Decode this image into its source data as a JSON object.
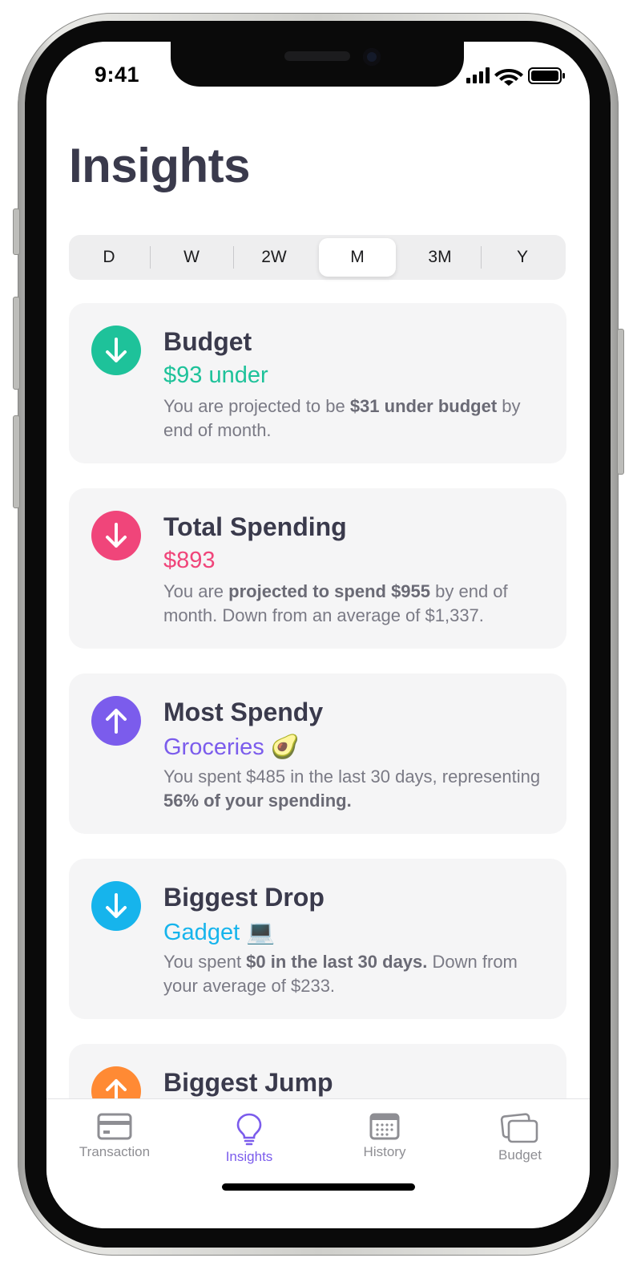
{
  "status_bar": {
    "time": "9:41"
  },
  "header": {
    "title": "Insights"
  },
  "period_selector": {
    "options": [
      "D",
      "W",
      "2W",
      "M",
      "3M",
      "Y"
    ],
    "selected": "M"
  },
  "cards": [
    {
      "title": "Budget",
      "value": "$93 under",
      "value_color": "#1ec29a",
      "icon": "arrow-down-icon",
      "icon_color": "#1ec29a",
      "desc_1": "You are projected to be ",
      "desc_bold_1": "$31 under budget",
      "desc_2": " by end of month."
    },
    {
      "title": "Total Spending",
      "value": "$893",
      "value_color": "#f0457a",
      "icon": "arrow-down-icon",
      "icon_color": "#f0457a",
      "desc_1": "You are ",
      "desc_bold_1": "projected to spend $955",
      "desc_2": " by end of month. Down from an average of $1,337."
    },
    {
      "title": "Most Spendy",
      "value": "Groceries",
      "value_emoji": "🥑",
      "value_color": "#7b5cec",
      "icon": "arrow-up-icon",
      "icon_color": "#7b5cec",
      "desc_1": "You spent $485 in the last 30 days, representing ",
      "desc_bold_1": "56% of your spending."
    },
    {
      "title": "Biggest Drop",
      "value": "Gadget",
      "value_emoji": "💻",
      "value_color": "#16b4ec",
      "icon": "arrow-down-icon",
      "icon_color": "#16b4ec",
      "desc_1": "You spent ",
      "desc_bold_1": "$0 in the last 30 days.",
      "desc_2": " Down from your average of $233."
    },
    {
      "title": "Biggest Jump",
      "icon": "arrow-up-icon",
      "icon_color": "#ff8a34"
    }
  ],
  "tab_bar": {
    "items": [
      {
        "label": "Transaction",
        "icon": "credit-card-icon"
      },
      {
        "label": "Insights",
        "icon": "lightbulb-icon",
        "active": true
      },
      {
        "label": "History",
        "icon": "calendar-icon"
      },
      {
        "label": "Budget",
        "icon": "cards-stack-icon"
      }
    ],
    "active_color": "#7b5cec"
  }
}
